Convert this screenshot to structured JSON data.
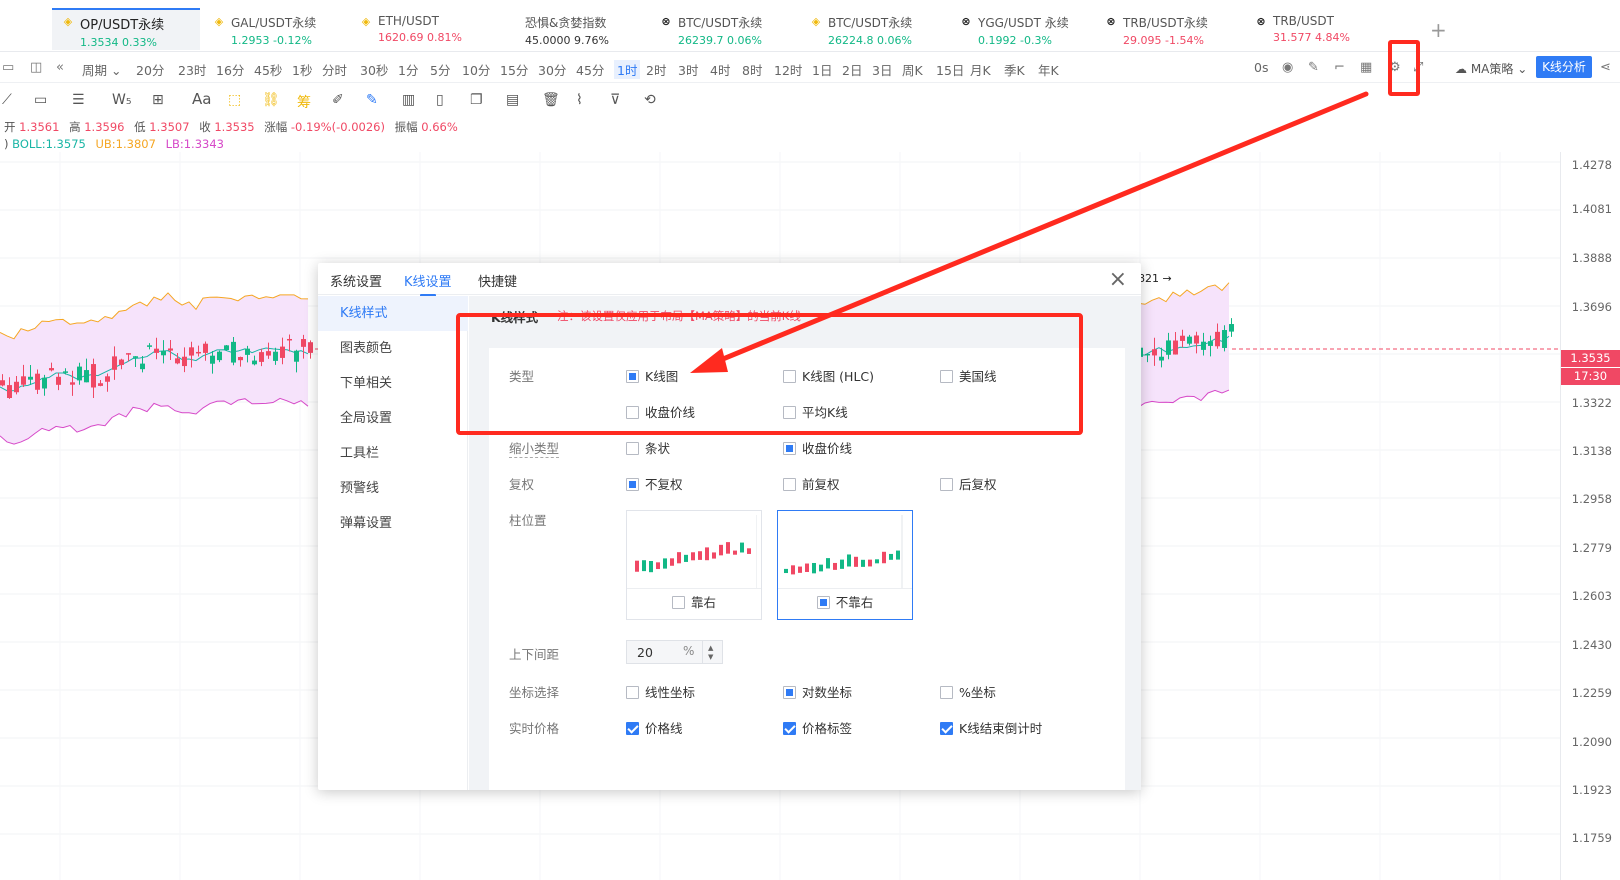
{
  "tabs": [
    {
      "name": "OP/USDT永续",
      "price": "1.3534",
      "change": "0.33%",
      "dir": "up",
      "icon": "bnb-icon",
      "active": true
    },
    {
      "name": "GAL/USDT永续",
      "price": "1.2953",
      "change": "-0.12%",
      "dir": "up",
      "icon": "bnb-icon",
      "active": false
    },
    {
      "name": "ETH/USDT",
      "price": "1620.69",
      "change": "0.81%",
      "dir": "down",
      "icon": "bnb-icon",
      "active": false
    },
    {
      "name": "恐惧&贪婪指数",
      "price": "45.0000",
      "change": "9.76%",
      "dir": "plain",
      "icon": "",
      "active": false
    },
    {
      "name": "BTC/USDT永续",
      "price": "26239.7",
      "change": "0.06%",
      "dir": "up",
      "icon": "okx-icon",
      "active": false
    },
    {
      "name": "BTC/USDT永续",
      "price": "26224.8",
      "change": "0.06%",
      "dir": "up",
      "icon": "bnb-icon",
      "active": false
    },
    {
      "name": "YGG/USDT 永续",
      "price": "0.1992",
      "change": "-0.3%",
      "dir": "up",
      "icon": "okx-icon",
      "active": false
    },
    {
      "name": "TRB/USDT永续",
      "price": "29.095",
      "change": "-1.54%",
      "dir": "down",
      "icon": "okx-icon",
      "active": false
    },
    {
      "name": "TRB/USDT",
      "price": "31.577",
      "change": "4.84%",
      "dir": "down",
      "icon": "okx-icon",
      "active": false
    }
  ],
  "toolbar": {
    "period_label": "周期",
    "intervals": [
      "20分",
      "23时",
      "16分",
      "45秒",
      "1秒",
      "分时",
      "30秒",
      "1分",
      "5分",
      "10分",
      "15分",
      "30分",
      "45分",
      "1时",
      "2时",
      "3时",
      "4时",
      "8时",
      "12时",
      "1日",
      "2日",
      "3日",
      "周K",
      "15日",
      "月K",
      "季K",
      "年K"
    ],
    "selected_interval": "1时",
    "delay": "0s",
    "strategy": "MA策略",
    "analysis_button": "K线分析"
  },
  "drawbar": {
    "text_tool": "Aa",
    "chip_tool": "筹"
  },
  "ohlc": {
    "open_label": "开",
    "open": "1.3561",
    "high_label": "高",
    "high": "1.3596",
    "low_label": "低",
    "low": "1.3507",
    "close_label": "收",
    "close": "1.3535",
    "change_label": "涨幅",
    "change": "-0.19%(-0.0026)",
    "amp_label": "振幅",
    "amp": "0.66%"
  },
  "boll": {
    "prefix": ")",
    "mid": "BOLL:1.3575",
    "ub": "UB:1.3807",
    "lb": "LB:1.3343"
  },
  "price_axis": {
    "ticks": [
      "1.4278",
      "1.4081",
      "1.3888",
      "1.3696",
      "1.3322",
      "1.3138",
      "1.2958",
      "1.2779",
      "1.2603",
      "1.2430",
      "1.2259",
      "1.2090",
      "1.1923",
      "1.1759"
    ],
    "last_price": "1.3535",
    "countdown": "17:30",
    "marker": "821 →"
  },
  "modal": {
    "tabs": [
      "系统设置",
      "K线设置",
      "快捷键"
    ],
    "active_tab": "K线设置",
    "close_symbol": "×",
    "sidebar": [
      "K线样式",
      "图表颜色",
      "下单相关",
      "全局设置",
      "工具栏",
      "预警线",
      "弹幕设置"
    ],
    "active_side": "K线样式",
    "section_title": "K线样式",
    "section_note": "注：该设置仅应用于布局【MA策略】的当前K线",
    "rows": {
      "type_label": "类型",
      "type_opts": [
        "K线图",
        "K线图 (HLC)",
        "美国线",
        "收盘价线",
        "平均K线"
      ],
      "shrink_label": "缩小类型",
      "shrink_opts": [
        "条状",
        "收盘价线"
      ],
      "adjust_label": "复权",
      "adjust_opts": [
        "不复权",
        "前复权",
        "后复权"
      ],
      "position_label": "柱位置",
      "position_opts": [
        "靠右",
        "不靠右"
      ],
      "spacing_label": "上下间距",
      "spacing_value": "20",
      "spacing_unit": "%",
      "axis_label": "坐标选择",
      "axis_opts": [
        "线性坐标",
        "对数坐标",
        "%坐标"
      ],
      "realtime_label": "实时价格",
      "realtime_opts": [
        "价格线",
        "价格标签",
        "K线结束倒计时"
      ]
    }
  },
  "colors": {
    "accent": "#2f7bf5",
    "up": "#12b886",
    "down": "#f04864",
    "annotation": "#ff2a1f"
  }
}
